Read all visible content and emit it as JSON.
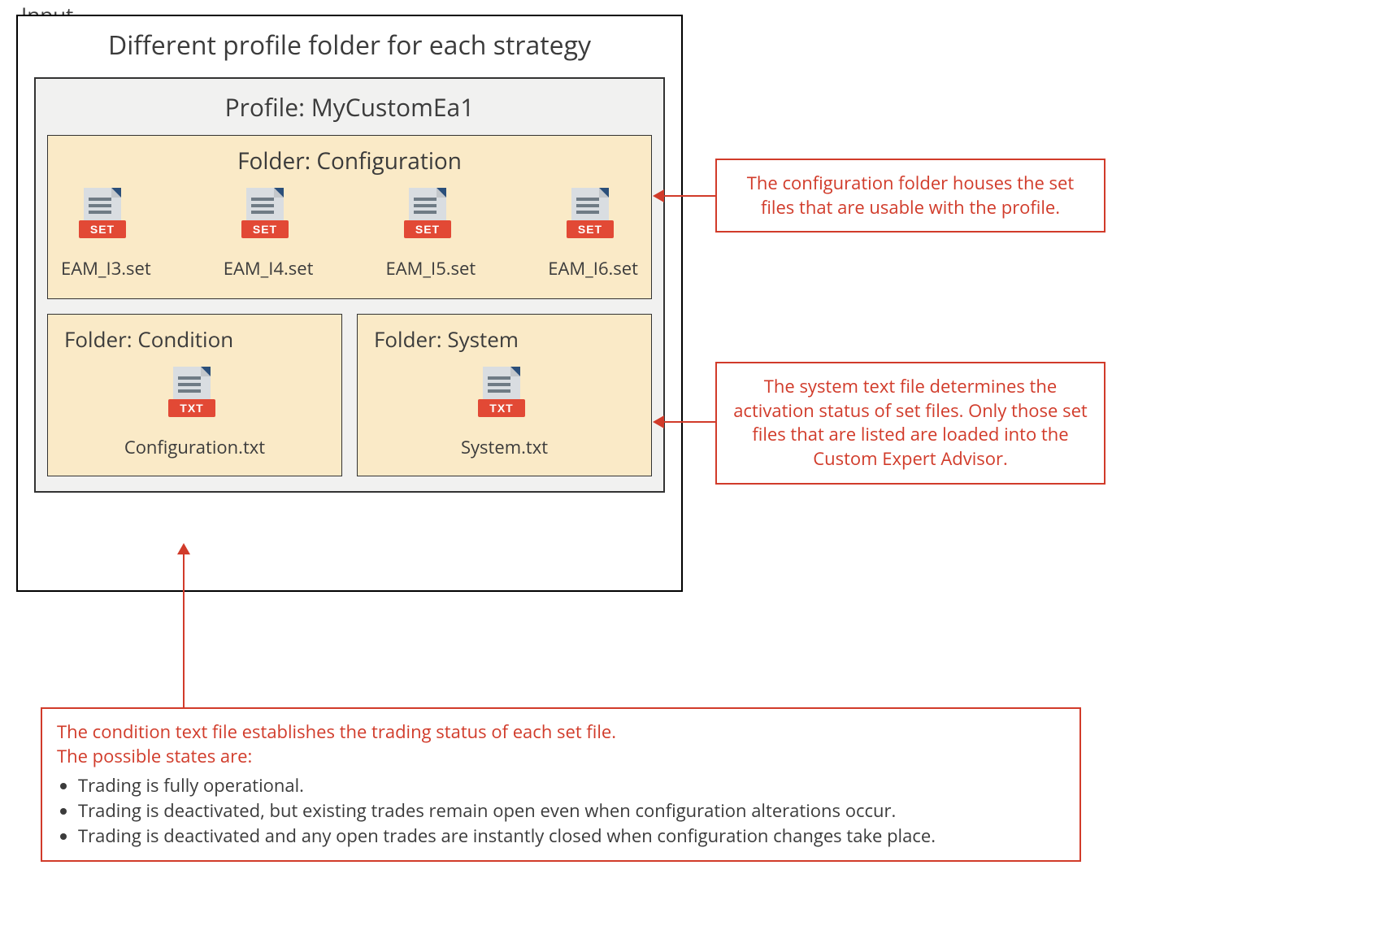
{
  "labels": {
    "input": "Input",
    "main_title": "Different profile folder for each strategy",
    "profile_title": "Profile: MyCustomEa1",
    "config_title": "Folder: Configuration",
    "condition_title": "Folder: Condition",
    "system_title": "Folder: System"
  },
  "files": {
    "config": [
      {
        "name": "EAM_I3.set",
        "badge": "SET"
      },
      {
        "name": "EAM_I4.set",
        "badge": "SET"
      },
      {
        "name": "EAM_I5.set",
        "badge": "SET"
      },
      {
        "name": "EAM_I6.set",
        "badge": "SET"
      }
    ],
    "condition": {
      "name": "Configuration.txt",
      "badge": "TXT"
    },
    "system": {
      "name": "System.txt",
      "badge": "TXT"
    }
  },
  "callouts": {
    "config_note": "The configuration folder houses the set files that are usable with the profile.",
    "system_note": "The system text file determines the activation status of set files. Only those set files that are listed are loaded into the Custom Expert Advisor.",
    "condition_lead1": "The condition text file establishes the trading status of each set file.",
    "condition_lead2": "The possible states are:",
    "condition_bullets": [
      "Trading is fully operational.",
      "Trading is deactivated, but existing trades remain open even when configuration alterations occur.",
      "Trading is deactivated and any open trades are instantly closed when configuration changes take place."
    ]
  }
}
